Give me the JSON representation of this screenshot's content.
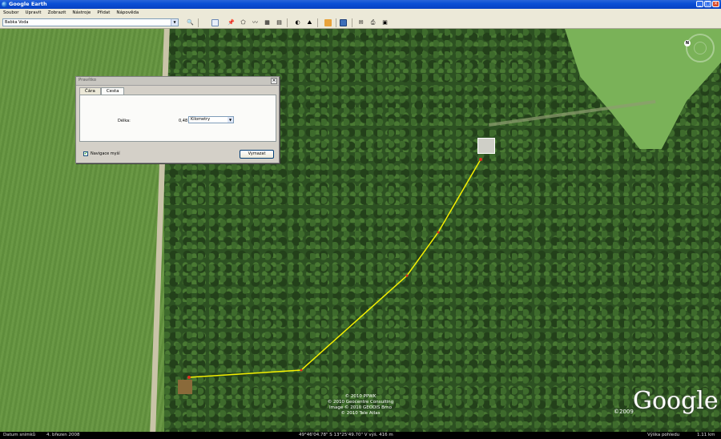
{
  "window": {
    "title": "Google Earth",
    "minimize": "_",
    "maximize": "□",
    "close": "×"
  },
  "menu": [
    "Soubor",
    "Upravit",
    "Zobrazit",
    "Nástroje",
    "Přidat",
    "Nápověda"
  ],
  "search": {
    "value": "Babka Voda"
  },
  "toolbar": {
    "icons": [
      "search-icon",
      "sidebar-icon",
      "placemark-icon",
      "polygon-icon",
      "path-icon",
      "overlay-icon",
      "tour-icon",
      "sun-icon",
      "sky-icon",
      "ruler-icon",
      "active-tool-icon",
      "email-icon",
      "print-icon",
      "maps-icon"
    ]
  },
  "map": {
    "credits": [
      "© 2010 PPWK",
      "© 2010 Geocentre Consulting",
      "Image © 2010 GEODIS Brno",
      "© 2010 Tele Atlas"
    ],
    "logo": "Google",
    "logo_year": "©2009",
    "compass_n": "N"
  },
  "ruler": {
    "title": "Pravítko",
    "tabs": [
      "Čára",
      "Cesta"
    ],
    "active_tab": "Cesta",
    "length_label": "Délka:",
    "length_value": "0,48",
    "unit": "Kilometry",
    "nav_label": "Navigace myší",
    "nav_checked": "✔",
    "clear_label": "Vymazat"
  },
  "status": {
    "date_label": "Datum snímků",
    "date_value": "4. březen 2008",
    "coords": "49°46'04.78\" S   13°25'49.70\" V   výš.  416 m",
    "view_label": "Výška pohledu",
    "view_value": "1.11 km"
  }
}
